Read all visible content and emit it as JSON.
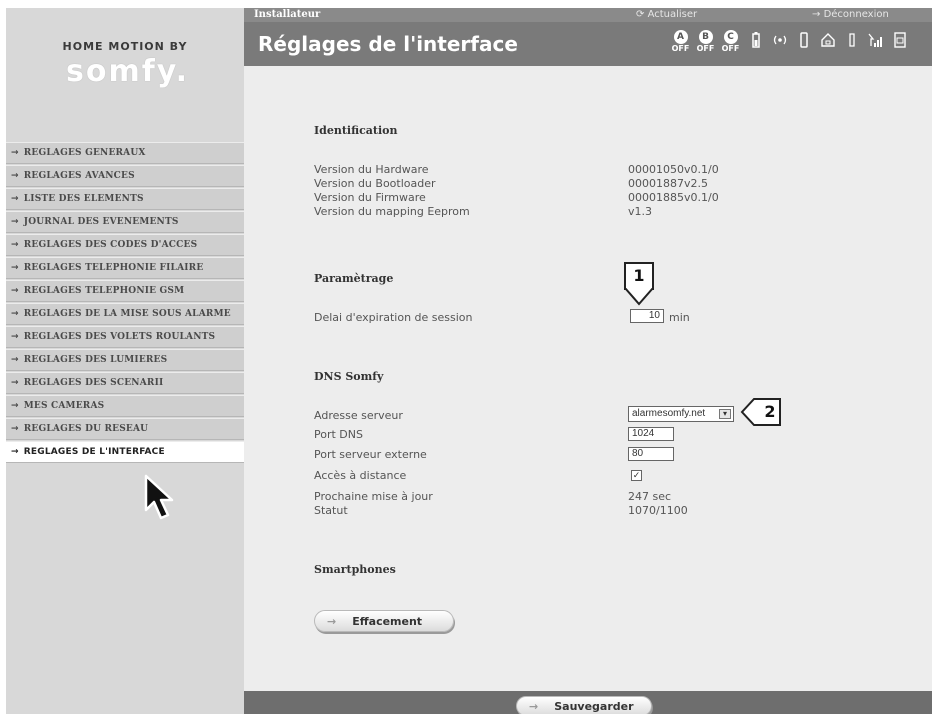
{
  "brand": {
    "tagline": "HOME MOTION BY",
    "logo": "somfy."
  },
  "header": {
    "section_label": "Installateur",
    "refresh_label": "Actualiser",
    "logout_label": "Déconnexion",
    "title": "Réglages de l'interface",
    "zones": [
      {
        "letter": "A",
        "state": "OFF"
      },
      {
        "letter": "B",
        "state": "OFF"
      },
      {
        "letter": "C",
        "state": "OFF"
      }
    ],
    "status_icons": [
      "battery-icon",
      "radio-signal-icon",
      "sensor-icon",
      "home-icon",
      "siren-icon",
      "gsm-signal-icon",
      "sim-card-icon"
    ]
  },
  "menu": {
    "items": [
      {
        "label": "REGLAGES GENERAUX",
        "active": false
      },
      {
        "label": "REGLAGES AVANCES",
        "active": false
      },
      {
        "label": "LISTE DES ELEMENTS",
        "active": false
      },
      {
        "label": "JOURNAL DES EVENEMENTS",
        "active": false
      },
      {
        "label": "REGLAGES DES CODES D'ACCES",
        "active": false
      },
      {
        "label": "REGLAGES TELEPHONIE FILAIRE",
        "active": false
      },
      {
        "label": "REGLAGES TELEPHONIE GSM",
        "active": false
      },
      {
        "label": "REGLAGES DE LA MISE SOUS ALARME",
        "active": false
      },
      {
        "label": "REGLAGES DES VOLETS ROULANTS",
        "active": false
      },
      {
        "label": "REGLAGES DES LUMIERES",
        "active": false
      },
      {
        "label": "REGLAGES DES SCENARII",
        "active": false
      },
      {
        "label": "MES CAMERAS",
        "active": false
      },
      {
        "label": "REGLAGES DU RESEAU",
        "active": false
      },
      {
        "label": "REGLAGES DE L'INTERFACE",
        "active": true
      }
    ]
  },
  "identification": {
    "title": "Identification",
    "rows": [
      {
        "label": "Version du Hardware",
        "value": "00001050v0.1/0"
      },
      {
        "label": "Version du Bootloader",
        "value": "00001887v2.5"
      },
      {
        "label": "Version du Firmware",
        "value": "00001885v0.1/0"
      },
      {
        "label": "Version du mapping Eeprom",
        "value": "v1.3"
      }
    ]
  },
  "parametrage": {
    "title": "Paramètrage",
    "session_label": "Delai d'expiration de session",
    "session_value": "10",
    "session_unit": "min"
  },
  "dns": {
    "title": "DNS Somfy",
    "server_label": "Adresse serveur",
    "server_value": "alarmesomfy.net",
    "dns_port_label": "Port DNS",
    "dns_port_value": "1024",
    "ext_port_label": "Port serveur externe",
    "ext_port_value": "80",
    "remote_label": "Accès à distance",
    "remote_checked": true,
    "next_update_label": "Prochaine mise à jour",
    "next_update_value": "247 sec",
    "status_label": "Statut",
    "status_value": "1070/1100"
  },
  "smartphones": {
    "title": "Smartphones",
    "erase_label": "Effacement"
  },
  "footer": {
    "save_label": "Sauvegarder"
  },
  "callouts": [
    "1",
    "2"
  ],
  "colors": {
    "sidebar": "#d8d8d8",
    "header_bar": "#7a7a7a",
    "main_panel": "#ededed",
    "active_item": "#ffffff"
  }
}
